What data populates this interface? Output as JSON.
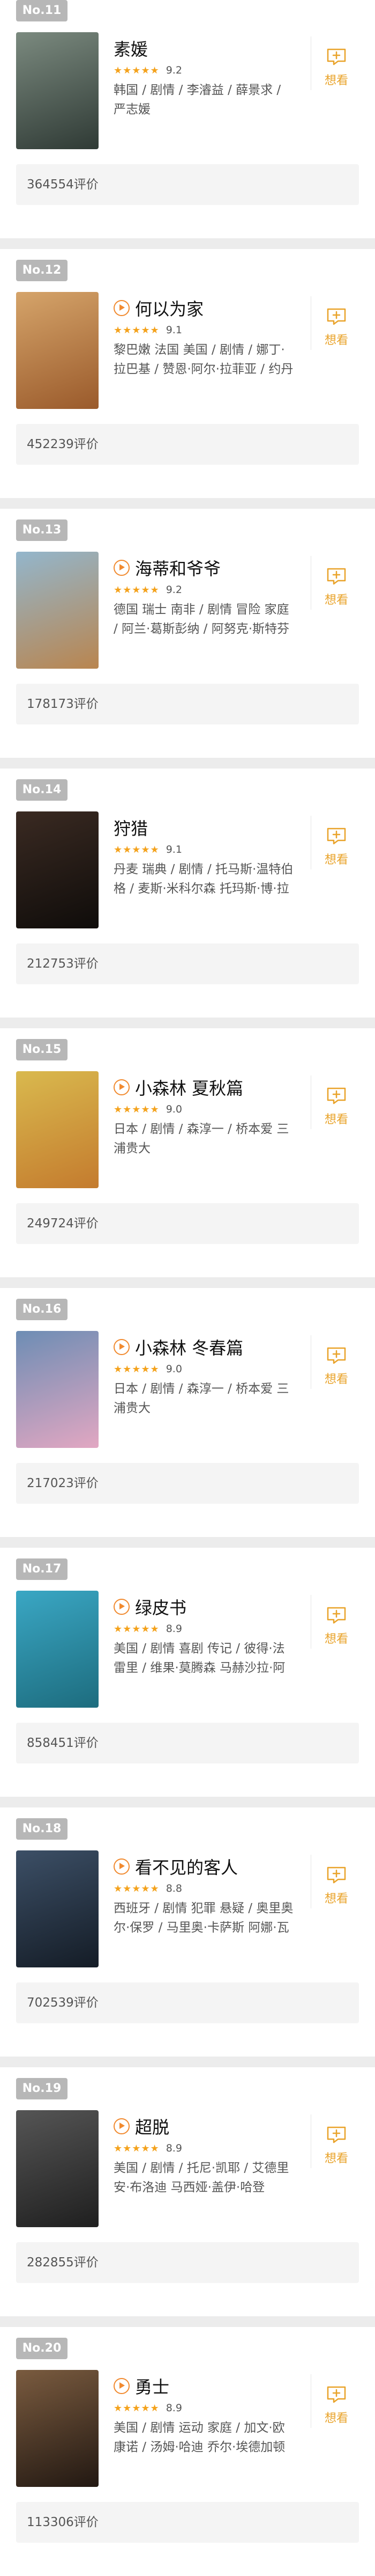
{
  "movies": [
    {
      "rank": "No.11",
      "title": "素媛",
      "has_play": false,
      "stars": "★★★★★",
      "score": "9.2",
      "meta": "韩国 / 剧情 / 李濬益 / 薛景求 / 严志媛",
      "reviews": "364554评价",
      "want": "想看",
      "poster_colors": [
        "#7b8a7f",
        "#2f3a35"
      ]
    },
    {
      "rank": "No.12",
      "title": "何以为家",
      "has_play": true,
      "stars": "★★★★★",
      "score": "9.1",
      "meta": "黎巴嫩 法国 美国 / 剧情 / 娜丁·拉巴基 / 赞恩·阿尔·拉菲亚 / 约丹诺斯·希费罗",
      "reviews": "452239评价",
      "want": "想看",
      "poster_colors": [
        "#d5a46a",
        "#9a5a2b"
      ]
    },
    {
      "rank": "No.13",
      "title": "海蒂和爷爷",
      "has_play": true,
      "stars": "★★★★★",
      "score": "9.2",
      "meta": "德国 瑞士 南非 / 剧情 冒险 家庭 / 阿兰·葛斯彭纳 / 阿努克·斯特芬",
      "reviews": "178173评价",
      "want": "想看",
      "poster_colors": [
        "#93b6cc",
        "#b9854f"
      ]
    },
    {
      "rank": "No.14",
      "title": "狩猎",
      "has_play": false,
      "stars": "★★★★★",
      "score": "9.1",
      "meta": "丹麦 瑞典 / 剧情 / 托马斯·温特伯格 / 麦斯·米科尔森 托玛斯·博·拉森",
      "reviews": "212753评价",
      "want": "想看",
      "poster_colors": [
        "#3a2a22",
        "#0f0c0a"
      ]
    },
    {
      "rank": "No.15",
      "title": "小森林 夏秋篇",
      "has_play": true,
      "stars": "★★★★★",
      "score": "9.0",
      "meta": "日本 / 剧情 / 森淳一 / 桥本爱 三浦贵大",
      "reviews": "249724评价",
      "want": "想看",
      "poster_colors": [
        "#d9b94e",
        "#c47b2e"
      ]
    },
    {
      "rank": "No.16",
      "title": "小森林 冬春篇",
      "has_play": true,
      "stars": "★★★★★",
      "score": "9.0",
      "meta": "日本 / 剧情 / 森淳一 / 桥本爱 三浦贵大",
      "reviews": "217023评价",
      "want": "想看",
      "poster_colors": [
        "#6d8db4",
        "#e2a7c2"
      ]
    },
    {
      "rank": "No.17",
      "title": "绿皮书",
      "has_play": true,
      "stars": "★★★★★",
      "score": "8.9",
      "meta": "美国 / 剧情 喜剧 传记 / 彼得·法雷里 / 维果·莫腾森 马赫沙拉·阿里",
      "reviews": "858451评价",
      "want": "想看",
      "poster_colors": [
        "#3aa7c4",
        "#1d6c7e"
      ]
    },
    {
      "rank": "No.18",
      "title": "看不见的客人",
      "has_play": true,
      "stars": "★★★★★",
      "score": "8.8",
      "meta": "西班牙 / 剧情 犯罪 悬疑 / 奥里奥尔·保罗 / 马里奥·卡萨斯 阿娜·瓦格纳",
      "reviews": "702539评价",
      "want": "想看",
      "poster_colors": [
        "#3c4f66",
        "#141c26"
      ]
    },
    {
      "rank": "No.19",
      "title": "超脱",
      "has_play": true,
      "stars": "★★★★★",
      "score": "8.9",
      "meta": "美国 / 剧情 / 托尼·凯耶 / 艾德里安·布洛迪 马西娅·盖伊·哈登",
      "reviews": "282855评价",
      "want": "想看",
      "poster_colors": [
        "#555555",
        "#1f1f1f"
      ]
    },
    {
      "rank": "No.20",
      "title": "勇士",
      "has_play": true,
      "stars": "★★★★★",
      "score": "8.9",
      "meta": "美国 / 剧情 运动 家庭 / 加文·欧康诺 / 汤姆·哈迪 乔尔·埃德加顿",
      "reviews": "113306评价",
      "want": "想看",
      "poster_colors": [
        "#7a5b3f",
        "#221812"
      ]
    }
  ]
}
